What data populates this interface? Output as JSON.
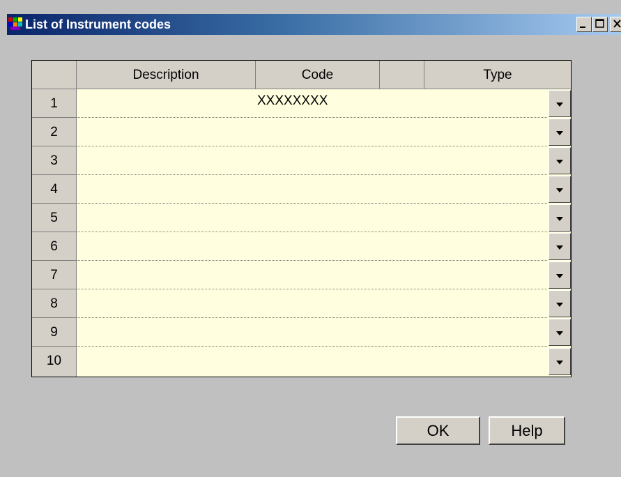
{
  "window": {
    "title": "List of Instrument codes"
  },
  "titlebar_buttons": {
    "minimize": "_",
    "maximize": "□",
    "close": "✕"
  },
  "table": {
    "headers": [
      "Description",
      "Code",
      "",
      "Type"
    ],
    "rows": [
      {
        "number": "1",
        "description": "",
        "code": "XXXXXXXX",
        "type": ""
      },
      {
        "number": "2",
        "description": "",
        "code": "",
        "type": ""
      },
      {
        "number": "3",
        "description": "",
        "code": "",
        "type": ""
      },
      {
        "number": "4",
        "description": "",
        "code": "",
        "type": ""
      },
      {
        "number": "5",
        "description": "",
        "code": "",
        "type": ""
      },
      {
        "number": "6",
        "description": "",
        "code": "",
        "type": ""
      },
      {
        "number": "7",
        "description": "",
        "code": "",
        "type": ""
      },
      {
        "number": "8",
        "description": "",
        "code": "",
        "type": ""
      },
      {
        "number": "9",
        "description": "",
        "code": "",
        "type": ""
      },
      {
        "number": "10",
        "description": "",
        "code": "",
        "type": ""
      }
    ]
  },
  "buttons": {
    "ok": "OK",
    "help": "Help"
  },
  "colors": {
    "title_start": "#0a246a",
    "title_end": "#a6caf0",
    "cell_bg": "#ffffe0",
    "face": "#c0c0c0"
  }
}
